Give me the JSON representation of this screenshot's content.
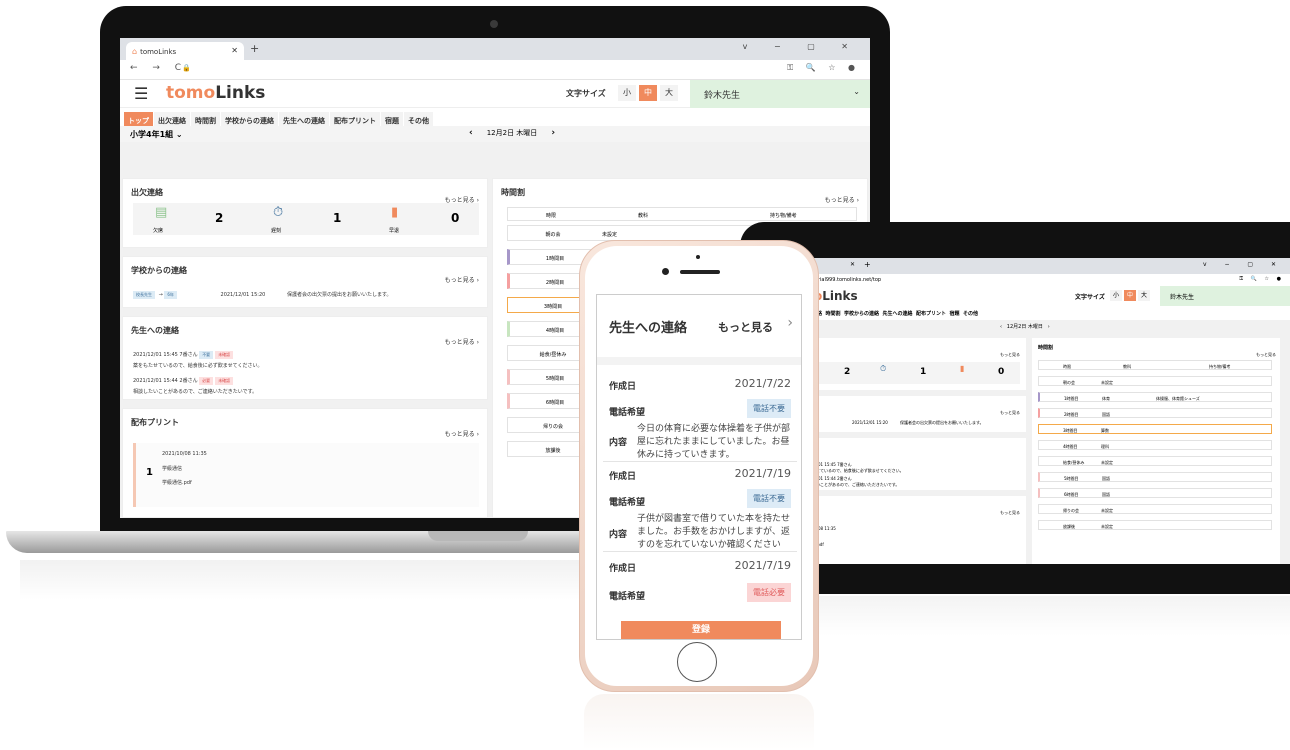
{
  "browser": {
    "tab_title": "tomoLinks",
    "new_tab": "+",
    "nav": "← → C",
    "tools": "⚿ 🔍 ☆ ●",
    "window_controls": "v − ▢ ✕",
    "tablet_url": "trial999.tomolinks.net/top"
  },
  "app": {
    "logo_prefix": "tomo",
    "logo_suffix": "Links",
    "font_size_label": "文字サイズ",
    "font_sizes": [
      "小",
      "中",
      "大"
    ],
    "user_name": "鈴木先生",
    "menu": [
      "トップ",
      "出欠連絡",
      "時間割",
      "学校からの連絡",
      "先生への連絡",
      "配布プリント",
      "宿題",
      "その他"
    ],
    "class_selector": "小学4年1組",
    "date": "12月2日 木曜日"
  },
  "attendance": {
    "title": "出欠連絡",
    "more": "もっと見る",
    "items": [
      {
        "label": "欠席",
        "value": "2"
      },
      {
        "label": "遅刻",
        "value": "1"
      },
      {
        "label": "早退",
        "value": "0"
      }
    ]
  },
  "school_notice": {
    "title": "学校からの連絡",
    "more": "もっと見る",
    "from": "校長先生",
    "to": "6年",
    "datetime": "2021/12/01 15:20",
    "text": "保護者会の出欠票の提出をお願いいたします。"
  },
  "teacher_contact": {
    "title": "先生への連絡",
    "more": "もっと見る",
    "items": [
      {
        "meta": "2021/12/01 15:45 7番さん",
        "tag1": "不要",
        "tag2": "未確認",
        "text": "薬をもたせているので、給食後に必ず飲ませてください。"
      },
      {
        "meta": "2021/12/01 15:44 2番さん",
        "tag1": "必要",
        "tag2": "未確認",
        "text": "相談したいことがあるので、ご連絡いただきたいです。"
      }
    ]
  },
  "prints": {
    "title": "配布プリント",
    "more": "もっと見る",
    "index": "1",
    "datetime": "2021/10/08 11:35",
    "name": "学級通信",
    "file": "学級通信.pdf"
  },
  "timetable": {
    "title": "時間割",
    "more": "もっと見る",
    "headers": [
      "時限",
      "教科",
      "持ち物/備考"
    ],
    "rows": [
      {
        "period": "朝の会",
        "subject": "未設定"
      },
      {
        "period": "1時間目",
        "subject": ""
      },
      {
        "period": "2時間目",
        "subject": ""
      },
      {
        "period": "3時間目",
        "subject": ""
      },
      {
        "period": "4時間目",
        "subject": ""
      },
      {
        "period": "給食/昼休み",
        "subject": ""
      },
      {
        "period": "5時間目",
        "subject": ""
      },
      {
        "period": "6時間目",
        "subject": ""
      },
      {
        "period": "帰りの会",
        "subject": ""
      },
      {
        "period": "放課後",
        "subject": ""
      }
    ],
    "tablet_rows": [
      {
        "period": "朝の会",
        "subject": "未設定",
        "note": ""
      },
      {
        "period": "1時間目",
        "subject": "体育",
        "note": "体操服、体育館シューズ"
      },
      {
        "period": "2時間目",
        "subject": "国語",
        "note": ""
      },
      {
        "period": "3時間目",
        "subject": "算数",
        "note": ""
      },
      {
        "period": "4時間目",
        "subject": "理科",
        "note": ""
      },
      {
        "period": "給食/昼休み",
        "subject": "未設定",
        "note": ""
      },
      {
        "period": "5時間目",
        "subject": "国語",
        "note": ""
      },
      {
        "period": "6時間目",
        "subject": "国語",
        "note": ""
      },
      {
        "period": "帰りの会",
        "subject": "未設定",
        "note": ""
      },
      {
        "period": "放課後",
        "subject": "未設定",
        "note": ""
      }
    ]
  },
  "phone": {
    "title": "先生への連絡",
    "more": "もっと見る",
    "entries": [
      {
        "created_label": "作成日",
        "created": "2021/7/22",
        "phone_label": "電話希望",
        "phone": "電話不要",
        "content_label": "内容",
        "content": "今日の体育に必要な体操着を子供が部屋に忘れたままにしていました。お昼休みに持っていきます。"
      },
      {
        "created_label": "作成日",
        "created": "2021/7/19",
        "phone_label": "電話希望",
        "phone": "電話不要",
        "content_label": "内容",
        "content": "子供が図書室で借りていた本を持たせました。お手数をおかけしますが、返すのを忘れていないか確認ください"
      },
      {
        "created_label": "作成日",
        "created": "2021/7/19",
        "phone_label": "電話希望",
        "phone": "電話必要"
      }
    ],
    "register": "登録"
  }
}
